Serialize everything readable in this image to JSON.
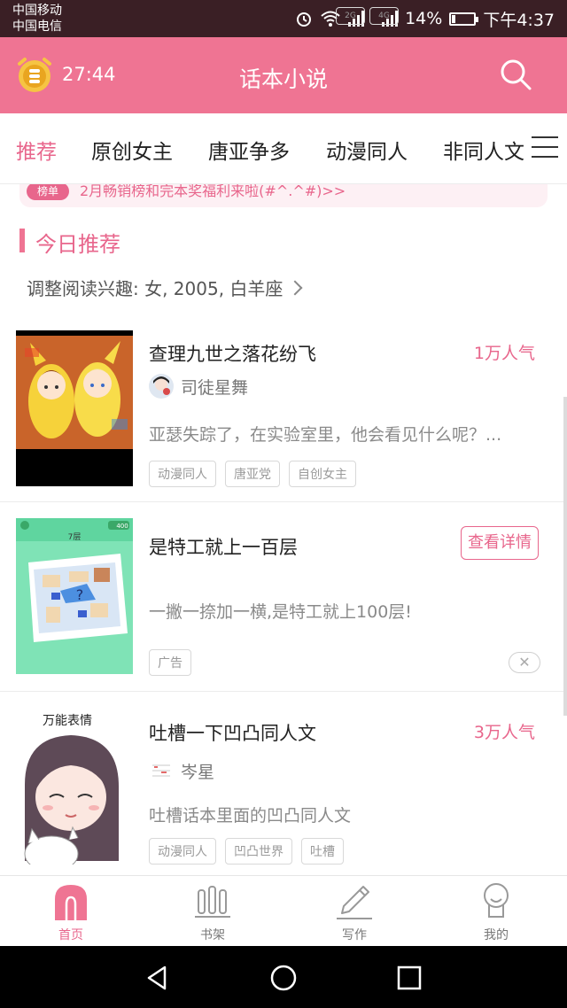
{
  "status_bar": {
    "carrier_1": "中国移动",
    "carrier_2": "中国电信",
    "net_1": "2G",
    "net_2": "4G",
    "battery": "14%",
    "time": "下午4:37"
  },
  "header": {
    "timer": "27:44",
    "title": "话本小说",
    "icons": [
      "alarm-clock-icon",
      "search-icon"
    ]
  },
  "tabs": [
    "推荐",
    "原创女主",
    "唐亚争多",
    "动漫同人",
    "非同人文"
  ],
  "banner": {
    "badge": "榜单",
    "text": "2月畅销榜和完本奖福利来啦(#^.^#)>>"
  },
  "section": {
    "title": "今日推荐",
    "interest": "调整阅读兴趣: 女, 2005, 白羊座"
  },
  "books": [
    {
      "title": "查理九世之落花纷飞",
      "popularity": "1万人气",
      "author": "司徒星舞",
      "summary": "亚瑟失踪了，在实验室里，他会看见什么呢？...",
      "tags": [
        "动漫同人",
        "唐亚党",
        "自创女主"
      ]
    },
    {
      "title": "吐槽一下凹凸同人文",
      "popularity": "3万人气",
      "author": "岑星",
      "summary": "吐槽话本里面的凹凸同人文",
      "tags": [
        "动漫同人",
        "凹凸世界",
        "吐槽"
      ],
      "cover_caption": "万能表情"
    }
  ],
  "ad": {
    "title": "是特工就上一百层",
    "summary": "一撇一捺加一横,是特工就上100层!",
    "label": "广告",
    "button": "查看详情",
    "close": "✕",
    "cover_level": "7层",
    "cover_score": "400"
  },
  "bottom_nav": [
    "首页",
    "书架",
    "写作",
    "我的"
  ],
  "colors": {
    "accent": "#ef7493",
    "accent_text": "#e8668c",
    "status_bar": "#3a1f25"
  }
}
